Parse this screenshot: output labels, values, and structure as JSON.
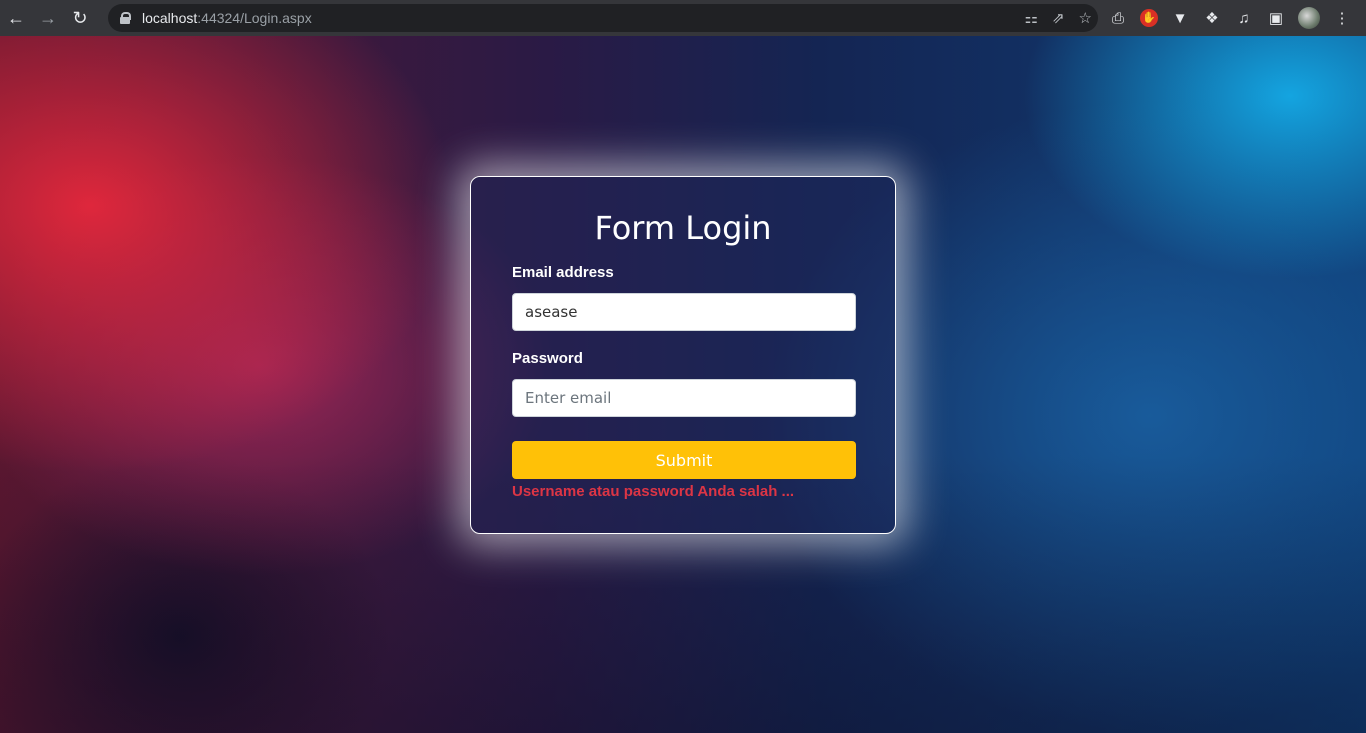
{
  "browser": {
    "url_host": "localhost",
    "url_rest": ":44324/Login.aspx"
  },
  "form": {
    "title": "Form Login",
    "email_label": "Email address",
    "email_value": "asease",
    "password_label": "Password",
    "password_placeholder": "Enter email",
    "submit_label": "Submit",
    "error_message": "Username atau password Anda salah ..."
  },
  "colors": {
    "submit_bg": "#ffc107",
    "error_text": "#dc3545"
  }
}
